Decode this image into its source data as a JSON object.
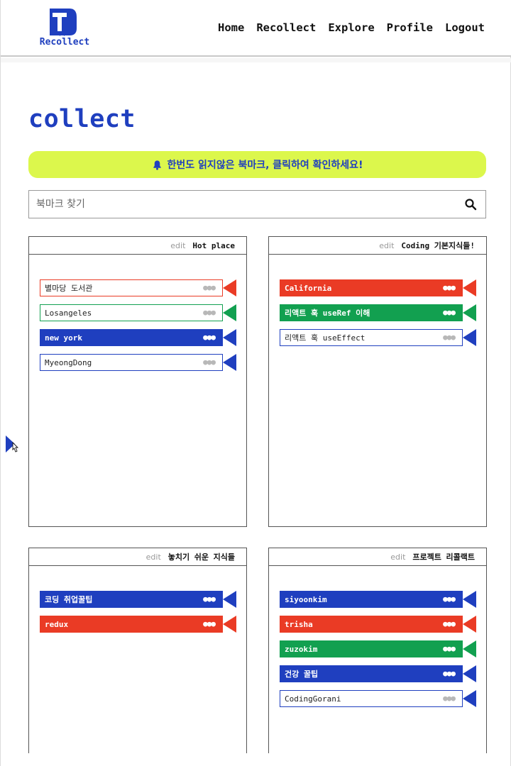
{
  "header": {
    "logo_text": "Recollect",
    "nav": [
      {
        "label": "Home"
      },
      {
        "label": "Recollect"
      },
      {
        "label": "Explore"
      },
      {
        "label": "Profile"
      },
      {
        "label": "Logout"
      }
    ]
  },
  "page_title": "collect",
  "notice": {
    "text": "한번도 읽지않은 북마크, 클릭하여 확인하세요!",
    "icon": "bell-icon"
  },
  "search": {
    "placeholder": "북마크 찾기",
    "value": "",
    "icon": "search-icon"
  },
  "colors": {
    "brand_blue": "#1f3fbf",
    "red": "#ea3b25",
    "green": "#12a050",
    "highlight": "#dcf74c"
  },
  "folders": [
    {
      "edit_label": "edit",
      "name": "Hot place",
      "items": [
        {
          "label": "별마당 도서관",
          "style": "outline",
          "color": "#ea3b25"
        },
        {
          "label": "Losangeles",
          "style": "outline",
          "color": "#12a050"
        },
        {
          "label": "new york",
          "style": "filled",
          "color": "#1f3fbf"
        },
        {
          "label": "MyeongDong",
          "style": "outline",
          "color": "#1f3fbf"
        }
      ]
    },
    {
      "edit_label": "edit",
      "name": "Coding 기본지식들!",
      "items": [
        {
          "label": "California",
          "style": "filled",
          "color": "#ea3b25"
        },
        {
          "label": "리액트 훅 useRef 이해",
          "style": "filled",
          "color": "#12a050"
        },
        {
          "label": "리액트 훅 useEffect",
          "style": "outline",
          "color": "#1f3fbf"
        }
      ]
    },
    {
      "edit_label": "edit",
      "name": "놓치기 쉬운 지식들",
      "items": [
        {
          "label": "코딩 취업꿀팁",
          "style": "filled",
          "color": "#1f3fbf"
        },
        {
          "label": "redux",
          "style": "filled",
          "color": "#ea3b25"
        }
      ]
    },
    {
      "edit_label": "edit",
      "name": "프로젝트 리콜랙트",
      "items": [
        {
          "label": "siyoonkim",
          "style": "filled",
          "color": "#1f3fbf"
        },
        {
          "label": "trisha",
          "style": "filled",
          "color": "#ea3b25"
        },
        {
          "label": "zuzokim",
          "style": "filled",
          "color": "#12a050"
        },
        {
          "label": "건강 꿀팁",
          "style": "filled",
          "color": "#1f3fbf"
        },
        {
          "label": "CodingGorani",
          "style": "outline",
          "color": "#1f3fbf"
        }
      ]
    }
  ]
}
